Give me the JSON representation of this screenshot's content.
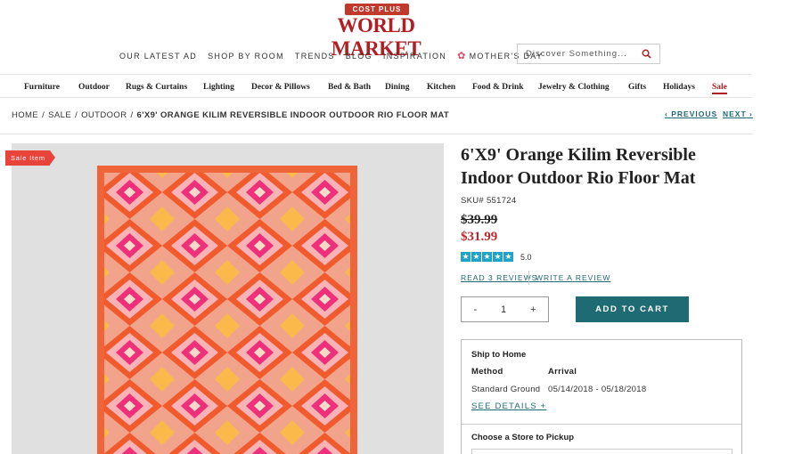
{
  "brand": {
    "top": "COST PLUS",
    "main": "WORLD MARKET"
  },
  "topnav": [
    "OUR LATEST AD",
    "SHOP BY ROOM",
    "TRENDS",
    "BLOG",
    "INSPIRATION",
    "MOTHER'S DAY"
  ],
  "search": {
    "placeholder": "Discover Something..."
  },
  "categories": [
    "Furniture",
    "Outdoor",
    "Rugs & Curtains",
    "Lighting",
    "Decor & Pillows",
    "Bed & Bath",
    "Dining",
    "Kitchen",
    "Food & Drink",
    "Jewelry & Clothing",
    "Gifts",
    "Holidays",
    "Sale"
  ],
  "breadcrumb": {
    "items": [
      "HOME",
      "SALE",
      "OUTDOOR"
    ],
    "current": "6'X9' ORANGE KILIM REVERSIBLE INDOOR OUTDOOR RIO FLOOR MAT"
  },
  "pager": {
    "prev": "PREVIOUS",
    "next": "NEXT"
  },
  "sale_tag": "Sale Item",
  "product": {
    "title": "6'X9' Orange Kilim Reversible Indoor Outdoor Rio Floor Mat",
    "sku": "SKU# 551724",
    "old_price": "$39.99",
    "price": "$31.99",
    "rating": 5.0,
    "rating_text": "5.0",
    "read_reviews": "READ 3 REVIEWS",
    "write_review": "WRITE A REVIEW",
    "qty_minus": "-",
    "qty": "1",
    "qty_plus": "+",
    "add_to_cart": "ADD TO CART"
  },
  "shipping": {
    "ship_title": "Ship to Home",
    "method_label": "Method",
    "arrival_label": "Arrival",
    "method": "Standard Ground",
    "arrival": "05/14/2018 - 05/18/2018",
    "see_details": "SEE DETAILS +",
    "pickup_title": "Choose a Store to Pickup"
  },
  "colors": {
    "brand_red": "#b11f24",
    "teal": "#1e6b74",
    "sale_red": "#c0272d",
    "star_blue": "#1fa3c8"
  },
  "icons": [
    "search-icon",
    "previous-chevron-icon",
    "next-chevron-icon",
    "flower-icon",
    "star-icon"
  ]
}
